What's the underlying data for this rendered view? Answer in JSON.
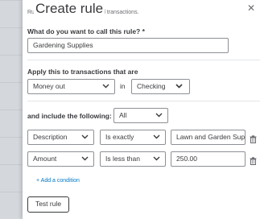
{
  "panel": {
    "title": "Create rule",
    "hint": "Rules only apply to unreviewed transactions.",
    "close_symbol": "✕"
  },
  "rule_name": {
    "label": "What do you want to call this rule? *",
    "value": "Gardening Supplies"
  },
  "apply": {
    "label": "Apply this to transactions that are",
    "direction": "Money out",
    "in_word": "in",
    "account": "Checking"
  },
  "include": {
    "label": "and include the following:",
    "match": "All"
  },
  "conditions": [
    {
      "field": "Description",
      "operator": "Is exactly",
      "value": "Lawn and Garden Sup"
    },
    {
      "field": "Amount",
      "operator": "Is less than",
      "value": "250.00"
    }
  ],
  "add_condition": "+ Add a condition",
  "test_button": "Test rule",
  "icons": {
    "close": "close-icon",
    "chevron": "chevron-down-icon",
    "trash": "trash-icon"
  },
  "colors": {
    "link": "#0077c5",
    "text": "#393a3d",
    "border": "#8d9096"
  }
}
